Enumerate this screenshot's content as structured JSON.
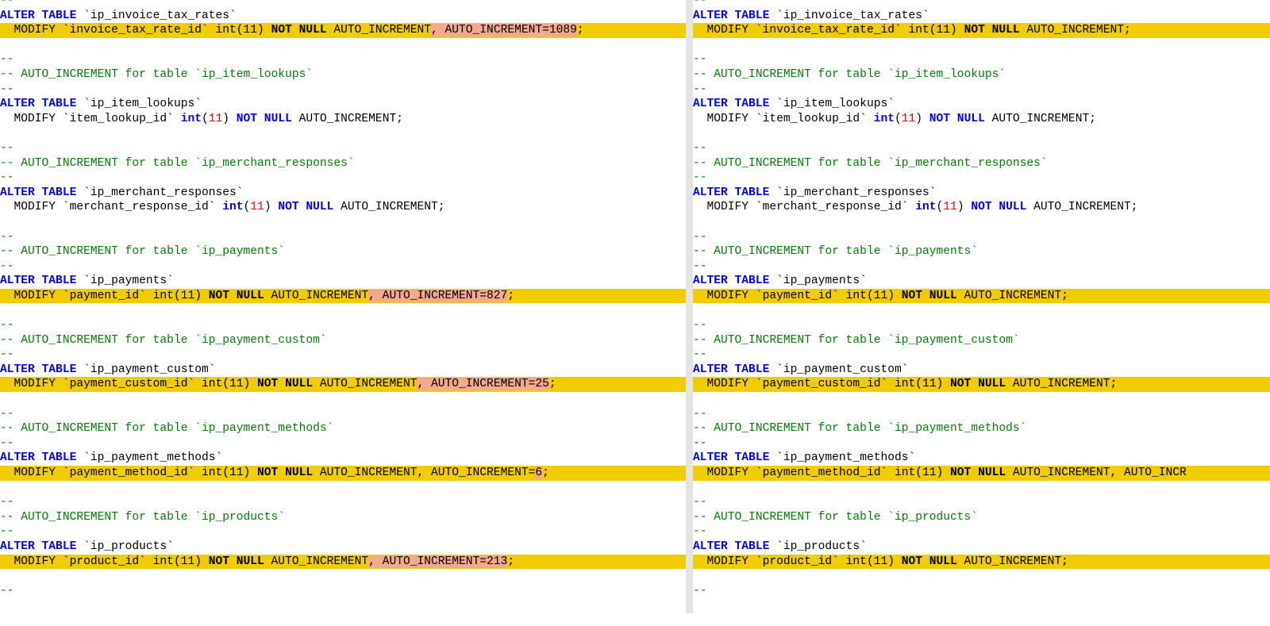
{
  "colors": {
    "changed_line": "#f0cc00",
    "inline_diff": "#f4a98a",
    "keyword": "#0000ff",
    "number": "#ff0000",
    "comment": "#008000"
  },
  "left": [
    {
      "changed": false,
      "segs": [
        {
          "t": "--",
          "c": "cm"
        }
      ]
    },
    {
      "changed": false,
      "segs": [
        {
          "t": "ALTER TABLE",
          "c": "kw"
        },
        {
          "t": " `ip_invoice_tax_rates`"
        }
      ]
    },
    {
      "changed": true,
      "segs": [
        {
          "t": "  MODIFY `invoice_tax_rate_id` int(11) "
        },
        {
          "t": "NOT NULL",
          "c": "kwb"
        },
        {
          "t": " AUTO_INCREMENT"
        },
        {
          "t": ", AUTO_INCREMENT=1089",
          "c": "diff"
        },
        {
          "t": ";"
        }
      ]
    },
    {
      "changed": false,
      "segs": [
        {
          "t": ""
        }
      ]
    },
    {
      "changed": false,
      "segs": [
        {
          "t": "--",
          "c": "cm"
        }
      ]
    },
    {
      "changed": false,
      "segs": [
        {
          "t": "-- AUTO_INCREMENT for table `ip_item_lookups`",
          "c": "cm"
        }
      ]
    },
    {
      "changed": false,
      "segs": [
        {
          "t": "--",
          "c": "cm"
        }
      ]
    },
    {
      "changed": false,
      "segs": [
        {
          "t": "ALTER TABLE",
          "c": "kw"
        },
        {
          "t": " `ip_item_lookups`"
        }
      ]
    },
    {
      "changed": false,
      "segs": [
        {
          "t": "  MODIFY `item_lookup_id` "
        },
        {
          "t": "int",
          "c": "kw"
        },
        {
          "t": "("
        },
        {
          "t": "11",
          "c": "num"
        },
        {
          "t": ") "
        },
        {
          "t": "NOT NULL",
          "c": "kw"
        },
        {
          "t": " AUTO_INCREMENT;"
        }
      ]
    },
    {
      "changed": false,
      "segs": [
        {
          "t": ""
        }
      ]
    },
    {
      "changed": false,
      "segs": [
        {
          "t": "--",
          "c": "cm"
        }
      ]
    },
    {
      "changed": false,
      "segs": [
        {
          "t": "-- AUTO_INCREMENT for table `ip_merchant_responses`",
          "c": "cm"
        }
      ]
    },
    {
      "changed": false,
      "segs": [
        {
          "t": "--",
          "c": "cm"
        }
      ]
    },
    {
      "changed": false,
      "segs": [
        {
          "t": "ALTER TABLE",
          "c": "kw"
        },
        {
          "t": " `ip_merchant_responses`"
        }
      ]
    },
    {
      "changed": false,
      "segs": [
        {
          "t": "  MODIFY `merchant_response_id` "
        },
        {
          "t": "int",
          "c": "kw"
        },
        {
          "t": "("
        },
        {
          "t": "11",
          "c": "num"
        },
        {
          "t": ") "
        },
        {
          "t": "NOT NULL",
          "c": "kw"
        },
        {
          "t": " AUTO_INCREMENT;"
        }
      ]
    },
    {
      "changed": false,
      "segs": [
        {
          "t": ""
        }
      ]
    },
    {
      "changed": false,
      "segs": [
        {
          "t": "--",
          "c": "cm"
        }
      ]
    },
    {
      "changed": false,
      "segs": [
        {
          "t": "-- AUTO_INCREMENT for table `ip_payments`",
          "c": "cm"
        }
      ]
    },
    {
      "changed": false,
      "segs": [
        {
          "t": "--",
          "c": "cm"
        }
      ]
    },
    {
      "changed": false,
      "segs": [
        {
          "t": "ALTER TABLE",
          "c": "kw"
        },
        {
          "t": " `ip_payments`"
        }
      ]
    },
    {
      "changed": true,
      "segs": [
        {
          "t": "  MODIFY `payment_id` int(11) "
        },
        {
          "t": "NOT NULL",
          "c": "kwb"
        },
        {
          "t": " AUTO_INCREMENT"
        },
        {
          "t": ", AUTO_INCREMENT=827",
          "c": "diff"
        },
        {
          "t": ";"
        }
      ]
    },
    {
      "changed": false,
      "segs": [
        {
          "t": ""
        }
      ]
    },
    {
      "changed": false,
      "segs": [
        {
          "t": "--",
          "c": "cm"
        }
      ]
    },
    {
      "changed": false,
      "segs": [
        {
          "t": "-- AUTO_INCREMENT for table `ip_payment_custom`",
          "c": "cm"
        }
      ]
    },
    {
      "changed": false,
      "segs": [
        {
          "t": "--",
          "c": "cm"
        }
      ]
    },
    {
      "changed": false,
      "segs": [
        {
          "t": "ALTER TABLE",
          "c": "kw"
        },
        {
          "t": " `ip_payment_custom`"
        }
      ]
    },
    {
      "changed": true,
      "segs": [
        {
          "t": "  MODIFY `payment_custom_id` int(11) "
        },
        {
          "t": "NOT NULL",
          "c": "kwb"
        },
        {
          "t": " AUTO_INCREMENT"
        },
        {
          "t": ", AUTO_INCREMENT=25",
          "c": "diff"
        },
        {
          "t": ";"
        }
      ]
    },
    {
      "changed": false,
      "segs": [
        {
          "t": ""
        }
      ]
    },
    {
      "changed": false,
      "segs": [
        {
          "t": "--",
          "c": "cm"
        }
      ]
    },
    {
      "changed": false,
      "segs": [
        {
          "t": "-- AUTO_INCREMENT for table `ip_payment_methods`",
          "c": "cm"
        }
      ]
    },
    {
      "changed": false,
      "segs": [
        {
          "t": "--",
          "c": "cm"
        }
      ]
    },
    {
      "changed": false,
      "segs": [
        {
          "t": "ALTER TABLE",
          "c": "kw"
        },
        {
          "t": " `ip_payment_methods`"
        }
      ]
    },
    {
      "changed": true,
      "segs": [
        {
          "t": "  MODIFY `payment_method_id` int(11) "
        },
        {
          "t": "NOT NULL",
          "c": "kwb"
        },
        {
          "t": " AUTO_INCREMENT, AUTO_INCREMENT="
        },
        {
          "t": "6",
          "c": "diff"
        },
        {
          "t": ";"
        }
      ]
    },
    {
      "changed": false,
      "segs": [
        {
          "t": ""
        }
      ]
    },
    {
      "changed": false,
      "segs": [
        {
          "t": "--",
          "c": "cm"
        }
      ]
    },
    {
      "changed": false,
      "segs": [
        {
          "t": "-- AUTO_INCREMENT for table `ip_products`",
          "c": "cm"
        }
      ]
    },
    {
      "changed": false,
      "segs": [
        {
          "t": "--",
          "c": "cm"
        }
      ]
    },
    {
      "changed": false,
      "segs": [
        {
          "t": "ALTER TABLE",
          "c": "kw"
        },
        {
          "t": " `ip_products`"
        }
      ]
    },
    {
      "changed": true,
      "segs": [
        {
          "t": "  MODIFY `product_id` int(11) "
        },
        {
          "t": "NOT NULL",
          "c": "kwb"
        },
        {
          "t": " AUTO_INCREMENT"
        },
        {
          "t": ", AUTO_INCREMENT=213",
          "c": "diff"
        },
        {
          "t": ";"
        }
      ]
    },
    {
      "changed": false,
      "segs": [
        {
          "t": ""
        }
      ]
    },
    {
      "changed": false,
      "segs": [
        {
          "t": "--",
          "c": "cm"
        }
      ]
    }
  ],
  "right": [
    {
      "changed": false,
      "segs": [
        {
          "t": "--",
          "c": "cm"
        }
      ]
    },
    {
      "changed": false,
      "segs": [
        {
          "t": "ALTER TABLE",
          "c": "kw"
        },
        {
          "t": " `ip_invoice_tax_rates`"
        }
      ]
    },
    {
      "changed": true,
      "segs": [
        {
          "t": "  MODIFY `invoice_tax_rate_id` int(11) "
        },
        {
          "t": "NOT NULL",
          "c": "kwb"
        },
        {
          "t": " AUTO_INCREMENT;"
        }
      ]
    },
    {
      "changed": false,
      "segs": [
        {
          "t": ""
        }
      ]
    },
    {
      "changed": false,
      "segs": [
        {
          "t": "--",
          "c": "cm"
        }
      ]
    },
    {
      "changed": false,
      "segs": [
        {
          "t": "-- AUTO_INCREMENT for table `ip_item_lookups`",
          "c": "cm"
        }
      ]
    },
    {
      "changed": false,
      "segs": [
        {
          "t": "--",
          "c": "cm"
        }
      ]
    },
    {
      "changed": false,
      "segs": [
        {
          "t": "ALTER TABLE",
          "c": "kw"
        },
        {
          "t": " `ip_item_lookups`"
        }
      ]
    },
    {
      "changed": false,
      "segs": [
        {
          "t": "  MODIFY `item_lookup_id` "
        },
        {
          "t": "int",
          "c": "kw"
        },
        {
          "t": "("
        },
        {
          "t": "11",
          "c": "num"
        },
        {
          "t": ") "
        },
        {
          "t": "NOT NULL",
          "c": "kw"
        },
        {
          "t": " AUTO_INCREMENT;"
        }
      ]
    },
    {
      "changed": false,
      "segs": [
        {
          "t": ""
        }
      ]
    },
    {
      "changed": false,
      "segs": [
        {
          "t": "--",
          "c": "cm"
        }
      ]
    },
    {
      "changed": false,
      "segs": [
        {
          "t": "-- AUTO_INCREMENT for table `ip_merchant_responses`",
          "c": "cm"
        }
      ]
    },
    {
      "changed": false,
      "segs": [
        {
          "t": "--",
          "c": "cm"
        }
      ]
    },
    {
      "changed": false,
      "segs": [
        {
          "t": "ALTER TABLE",
          "c": "kw"
        },
        {
          "t": " `ip_merchant_responses`"
        }
      ]
    },
    {
      "changed": false,
      "segs": [
        {
          "t": "  MODIFY `merchant_response_id` "
        },
        {
          "t": "int",
          "c": "kw"
        },
        {
          "t": "("
        },
        {
          "t": "11",
          "c": "num"
        },
        {
          "t": ") "
        },
        {
          "t": "NOT NULL",
          "c": "kw"
        },
        {
          "t": " AUTO_INCREMENT;"
        }
      ]
    },
    {
      "changed": false,
      "segs": [
        {
          "t": ""
        }
      ]
    },
    {
      "changed": false,
      "segs": [
        {
          "t": "--",
          "c": "cm"
        }
      ]
    },
    {
      "changed": false,
      "segs": [
        {
          "t": "-- AUTO_INCREMENT for table `ip_payments`",
          "c": "cm"
        }
      ]
    },
    {
      "changed": false,
      "segs": [
        {
          "t": "--",
          "c": "cm"
        }
      ]
    },
    {
      "changed": false,
      "segs": [
        {
          "t": "ALTER TABLE",
          "c": "kw"
        },
        {
          "t": " `ip_payments`"
        }
      ]
    },
    {
      "changed": true,
      "segs": [
        {
          "t": "  MODIFY `payment_id` int(11) "
        },
        {
          "t": "NOT NULL",
          "c": "kwb"
        },
        {
          "t": " AUTO_INCREMENT;"
        }
      ]
    },
    {
      "changed": false,
      "segs": [
        {
          "t": ""
        }
      ]
    },
    {
      "changed": false,
      "segs": [
        {
          "t": "--",
          "c": "cm"
        }
      ]
    },
    {
      "changed": false,
      "segs": [
        {
          "t": "-- AUTO_INCREMENT for table `ip_payment_custom`",
          "c": "cm"
        }
      ]
    },
    {
      "changed": false,
      "segs": [
        {
          "t": "--",
          "c": "cm"
        }
      ]
    },
    {
      "changed": false,
      "segs": [
        {
          "t": "ALTER TABLE",
          "c": "kw"
        },
        {
          "t": " `ip_payment_custom`"
        }
      ]
    },
    {
      "changed": true,
      "segs": [
        {
          "t": "  MODIFY `payment_custom_id` int(11) "
        },
        {
          "t": "NOT NULL",
          "c": "kwb"
        },
        {
          "t": " AUTO_INCREMENT;"
        }
      ]
    },
    {
      "changed": false,
      "segs": [
        {
          "t": ""
        }
      ]
    },
    {
      "changed": false,
      "segs": [
        {
          "t": "--",
          "c": "cm"
        }
      ]
    },
    {
      "changed": false,
      "segs": [
        {
          "t": "-- AUTO_INCREMENT for table `ip_payment_methods`",
          "c": "cm"
        }
      ]
    },
    {
      "changed": false,
      "segs": [
        {
          "t": "--",
          "c": "cm"
        }
      ]
    },
    {
      "changed": false,
      "segs": [
        {
          "t": "ALTER TABLE",
          "c": "kw"
        },
        {
          "t": " `ip_payment_methods`"
        }
      ]
    },
    {
      "changed": true,
      "segs": [
        {
          "t": "  MODIFY `payment_method_id` int(11) "
        },
        {
          "t": "NOT NULL",
          "c": "kwb"
        },
        {
          "t": " AUTO_INCREMENT, AUTO_INCR"
        }
      ]
    },
    {
      "changed": false,
      "segs": [
        {
          "t": ""
        }
      ]
    },
    {
      "changed": false,
      "segs": [
        {
          "t": "--",
          "c": "cm"
        }
      ]
    },
    {
      "changed": false,
      "segs": [
        {
          "t": "-- AUTO_INCREMENT for table `ip_products`",
          "c": "cm"
        }
      ]
    },
    {
      "changed": false,
      "segs": [
        {
          "t": "--",
          "c": "cm"
        }
      ]
    },
    {
      "changed": false,
      "segs": [
        {
          "t": "ALTER TABLE",
          "c": "kw"
        },
        {
          "t": " `ip_products`"
        }
      ]
    },
    {
      "changed": true,
      "segs": [
        {
          "t": "  MODIFY `product_id` int(11) "
        },
        {
          "t": "NOT NULL",
          "c": "kwb"
        },
        {
          "t": " AUTO_INCREMENT;"
        }
      ]
    },
    {
      "changed": false,
      "segs": [
        {
          "t": ""
        }
      ]
    },
    {
      "changed": false,
      "segs": [
        {
          "t": "--",
          "c": "cm"
        }
      ]
    }
  ]
}
